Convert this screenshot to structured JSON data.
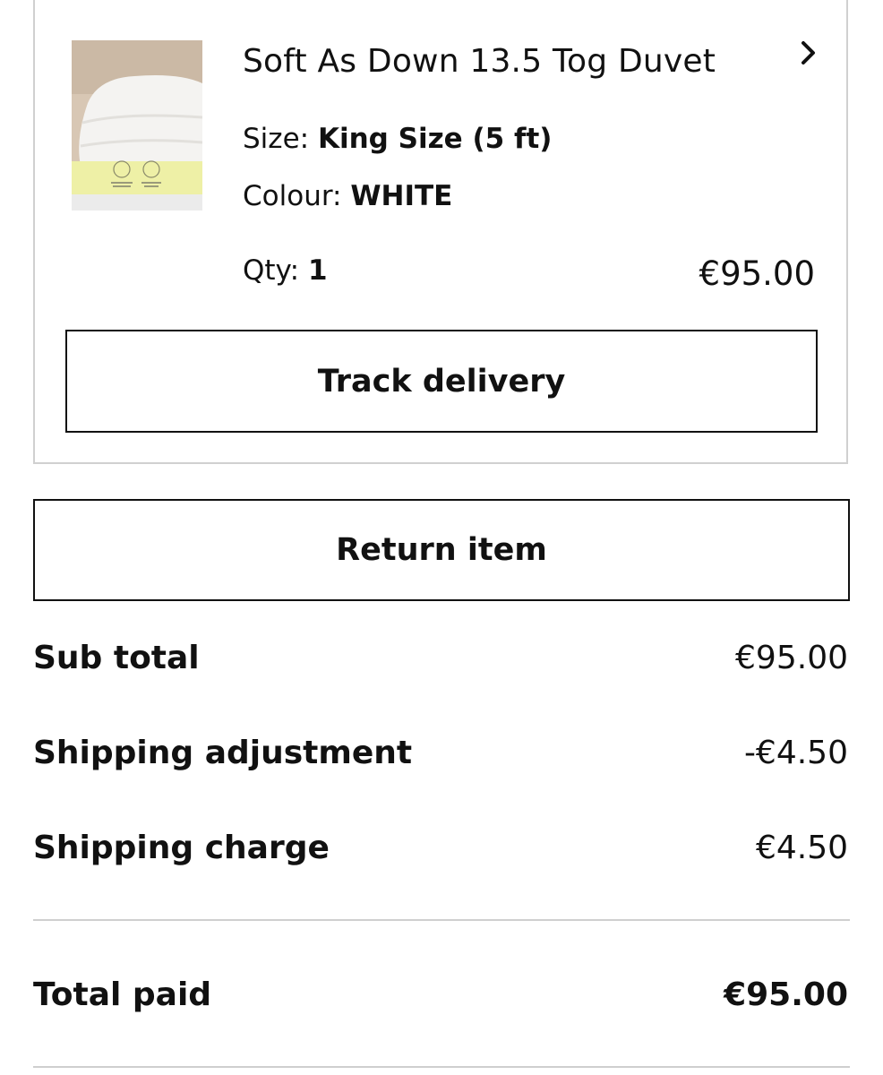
{
  "product": {
    "title": "Soft As Down 13.5 Tog Duvet",
    "size_label": "Size: ",
    "size_value": "King Size (5 ft)",
    "colour_label": "Colour: ",
    "colour_value": "WHITE",
    "qty_label": "Qty: ",
    "qty_value": "1",
    "price": "€95.00",
    "image_icon": "duvet-product-image",
    "chevron_icon": "chevron-right-icon"
  },
  "actions": {
    "track_label": "Track delivery",
    "return_label": "Return item"
  },
  "summary": {
    "rows": [
      {
        "label": "Sub total",
        "value": "€95.00"
      },
      {
        "label": "Shipping adjustment",
        "value": "-€4.50"
      },
      {
        "label": "Shipping charge",
        "value": "€4.50"
      }
    ],
    "total_label": "Total paid",
    "total_value": "€95.00"
  }
}
